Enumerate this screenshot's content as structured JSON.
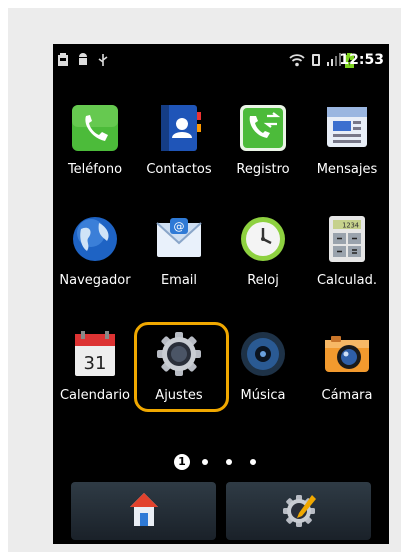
{
  "status_bar": {
    "time": "12:53",
    "left_icons": [
      "sd-card-icon",
      "android-debug-icon",
      "usb-icon"
    ],
    "right_icons": [
      "wifi-icon",
      "vibrate-icon",
      "signal-icon",
      "battery-icon"
    ]
  },
  "apps": [
    {
      "label": "Teléfono",
      "icon": "phone-icon"
    },
    {
      "label": "Contactos",
      "icon": "contacts-icon"
    },
    {
      "label": "Registro",
      "icon": "call-log-icon"
    },
    {
      "label": "Mensajes",
      "icon": "messages-icon"
    },
    {
      "label": "Navegador",
      "icon": "browser-globe-icon"
    },
    {
      "label": "Email",
      "icon": "email-icon"
    },
    {
      "label": "Reloj",
      "icon": "clock-icon"
    },
    {
      "label": "Calculad.",
      "icon": "calculator-icon"
    },
    {
      "label": "Calendario",
      "icon": "calendar-icon",
      "day": "31"
    },
    {
      "label": "Ajustes",
      "icon": "settings-gear-icon",
      "selected": true
    },
    {
      "label": "Música",
      "icon": "music-icon"
    },
    {
      "label": "Cámara",
      "icon": "camera-icon"
    }
  ],
  "pager": {
    "current": "1",
    "total_dots": 4
  },
  "calculator_display": "1234",
  "email_symbol": "@",
  "dock": [
    {
      "name": "home-button",
      "icon": "home-icon"
    },
    {
      "name": "settings-button",
      "icon": "settings-edit-icon"
    }
  ],
  "colors": {
    "selection": "#f0a800",
    "screen_bg": "#000000",
    "frame_bg": "#ececec"
  }
}
